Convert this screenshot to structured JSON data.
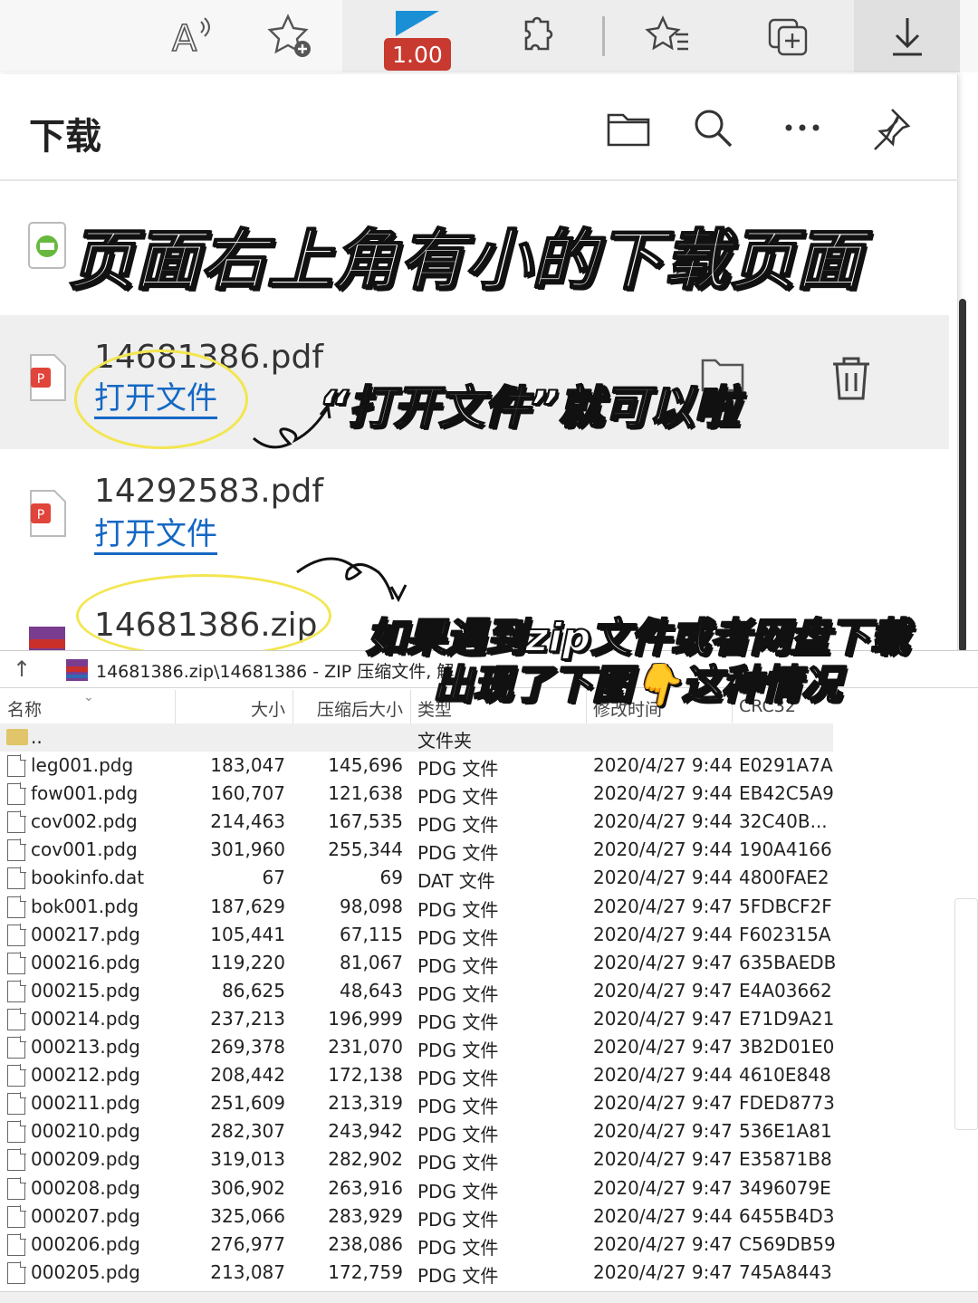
{
  "toolbar": {
    "read_aloud_icon": "read-aloud-icon",
    "add_favorite_icon": "add-favorite-icon",
    "playback_speed": "1.00",
    "extensions_icon": "extensions-icon",
    "favorites_icon": "favorites-icon",
    "collections_icon": "collections-icon",
    "downloads_icon": "download-icon",
    "colors": {
      "bar": "#f7f7f7",
      "badge": "#c8392f",
      "flag": "#1a8fd6"
    }
  },
  "panel": {
    "title": "下载",
    "items": [
      {
        "name": "",
        "open_label": ""
      },
      {
        "name": "14681386.pdf",
        "open_label": "打开文件"
      },
      {
        "name": "14292583.pdf",
        "open_label": "打开文件"
      },
      {
        "name": "14681386.zip",
        "open_label": ""
      }
    ],
    "link_color": "#1568c4"
  },
  "captions": {
    "top": "页面右上角有小的下载页面",
    "middle": "“打开文件”就可以啦",
    "bottom_line1": "如果遇到zip文件或者网盘下载",
    "bottom_line2": "出现了下图👇这种情况"
  },
  "archive": {
    "path": "14681386.zip\\14681386 - ZIP 压缩文件, 解",
    "columns": [
      "名称",
      "大小",
      "压缩后大小",
      "类型",
      "修改时间",
      "CRC32"
    ],
    "parent_row": {
      "name": "..",
      "type": "文件夹"
    },
    "rows": [
      [
        "leg001.pdg",
        "183,047",
        "145,696",
        "PDG 文件",
        "2020/4/27 9:44",
        "E0291A7A"
      ],
      [
        "fow001.pdg",
        "160,707",
        "121,638",
        "PDG 文件",
        "2020/4/27 9:44",
        "EB42C5A9"
      ],
      [
        "cov002.pdg",
        "214,463",
        "167,535",
        "PDG 文件",
        "2020/4/27 9:44",
        "32C40B..."
      ],
      [
        "cov001.pdg",
        "301,960",
        "255,344",
        "PDG 文件",
        "2020/4/27 9:44",
        "190A4166"
      ],
      [
        "bookinfo.dat",
        "67",
        "69",
        "DAT 文件",
        "2020/4/27 9:44",
        "4800FAE2"
      ],
      [
        "bok001.pdg",
        "187,629",
        "98,098",
        "PDG 文件",
        "2020/4/27 9:47",
        "5FDBCF2F"
      ],
      [
        "000217.pdg",
        "105,441",
        "67,115",
        "PDG 文件",
        "2020/4/27 9:44",
        "F602315A"
      ],
      [
        "000216.pdg",
        "119,220",
        "81,067",
        "PDG 文件",
        "2020/4/27 9:47",
        "635BAEDB"
      ],
      [
        "000215.pdg",
        "86,625",
        "48,643",
        "PDG 文件",
        "2020/4/27 9:47",
        "E4A03662"
      ],
      [
        "000214.pdg",
        "237,213",
        "196,999",
        "PDG 文件",
        "2020/4/27 9:47",
        "E71D9A21"
      ],
      [
        "000213.pdg",
        "269,378",
        "231,070",
        "PDG 文件",
        "2020/4/27 9:47",
        "3B2D01E0"
      ],
      [
        "000212.pdg",
        "208,442",
        "172,138",
        "PDG 文件",
        "2020/4/27 9:44",
        "4610E848"
      ],
      [
        "000211.pdg",
        "251,609",
        "213,319",
        "PDG 文件",
        "2020/4/27 9:47",
        "FDED8773"
      ],
      [
        "000210.pdg",
        "282,307",
        "243,942",
        "PDG 文件",
        "2020/4/27 9:47",
        "536E1A81"
      ],
      [
        "000209.pdg",
        "319,013",
        "282,902",
        "PDG 文件",
        "2020/4/27 9:47",
        "E35871B8"
      ],
      [
        "000208.pdg",
        "306,902",
        "263,916",
        "PDG 文件",
        "2020/4/27 9:47",
        "3496079E"
      ],
      [
        "000207.pdg",
        "325,066",
        "283,929",
        "PDG 文件",
        "2020/4/27 9:44",
        "6455B4D3"
      ],
      [
        "000206.pdg",
        "276,977",
        "238,086",
        "PDG 文件",
        "2020/4/27 9:47",
        "C569DB59"
      ],
      [
        "000205.pdg",
        "213,087",
        "172,759",
        "PDG 文件",
        "2020/4/27 9:47",
        "745A8443"
      ]
    ]
  }
}
